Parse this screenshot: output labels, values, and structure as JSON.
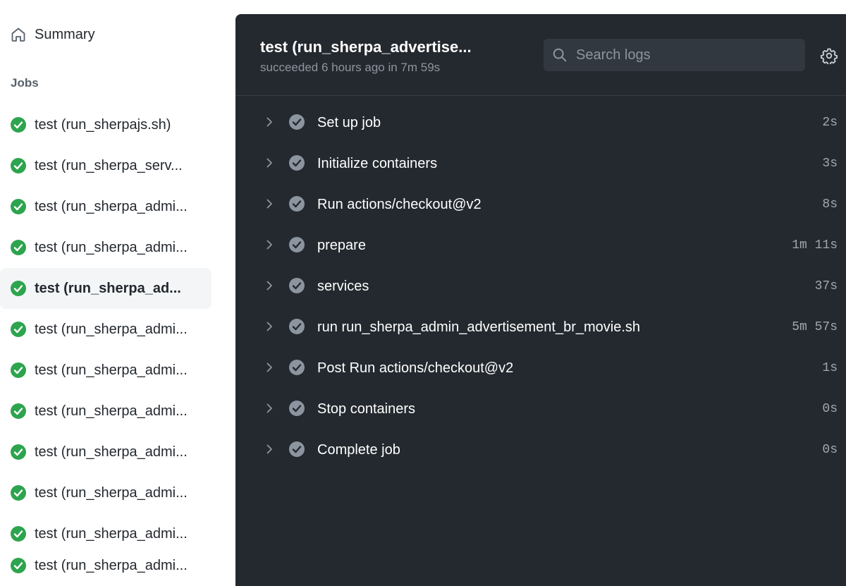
{
  "sidebar": {
    "summary_label": "Summary",
    "summary_icon": "home-icon",
    "jobs_heading": "Jobs",
    "status_color": "#2da44e",
    "jobs": [
      {
        "label": "test (run_sherpajs.sh)"
      },
      {
        "label": "test (run_sherpa_serv..."
      },
      {
        "label": "test (run_sherpa_admi..."
      },
      {
        "label": "test (run_sherpa_admi..."
      },
      {
        "label": "test (run_sherpa_ad...",
        "active": true
      },
      {
        "label": "test (run_sherpa_admi..."
      },
      {
        "label": "test (run_sherpa_admi..."
      },
      {
        "label": "test (run_sherpa_admi..."
      },
      {
        "label": "test (run_sherpa_admi..."
      },
      {
        "label": "test (run_sherpa_admi..."
      },
      {
        "label": "test (run_sherpa_admi..."
      },
      {
        "label": "test (run_sherpa_admi..."
      }
    ]
  },
  "main": {
    "title": "test (run_sherpa_advertise...",
    "subtitle": "succeeded 6 hours ago in 7m 59s",
    "search": {
      "placeholder": "Search logs",
      "icon": "search-icon"
    },
    "settings_icon": "gear-icon",
    "background_color": "#24292f",
    "steps": [
      {
        "label": "Set up job",
        "duration": "2s"
      },
      {
        "label": "Initialize containers",
        "duration": "3s"
      },
      {
        "label": "Run actions/checkout@v2",
        "duration": "8s"
      },
      {
        "label": "prepare",
        "duration": "1m 11s"
      },
      {
        "label": "services",
        "duration": "37s"
      },
      {
        "label": "run run_sherpa_admin_advertisement_br_movie.sh",
        "duration": "5m 57s"
      },
      {
        "label": "Post Run actions/checkout@v2",
        "duration": "1s"
      },
      {
        "label": "Stop containers",
        "duration": "0s"
      },
      {
        "label": "Complete job",
        "duration": "0s"
      }
    ]
  }
}
